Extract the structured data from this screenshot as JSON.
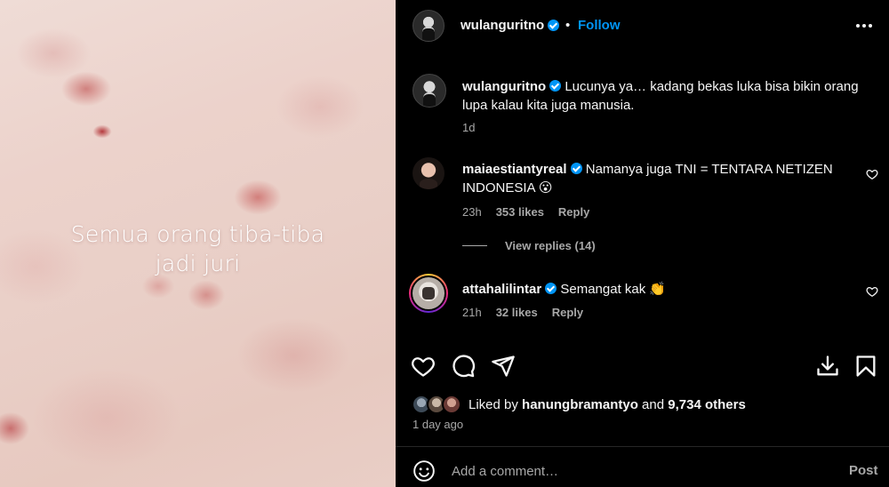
{
  "media": {
    "caption_lines": [
      "Semua orang tiba-tiba",
      "jadi juri"
    ]
  },
  "header": {
    "username": "wulanguritno",
    "dot": "•",
    "follow_label": "Follow"
  },
  "caption_comment": {
    "username": "wulanguritno",
    "text": "Lucunya ya… kadang bekas luka bisa bikin orang lupa kalau kita juga manusia.",
    "time": "1d"
  },
  "comments": [
    {
      "username": "maiaestiantyreal",
      "text": "Namanya juga TNI = TENTARA NETIZEN INDONESIA 😮",
      "time": "23h",
      "likes": "353 likes",
      "reply_label": "Reply"
    },
    {
      "username": "attahalilintar",
      "text": "Semangat kak 👏",
      "time": "21h",
      "likes": "32 likes",
      "reply_label": "Reply"
    }
  ],
  "view_replies": "View replies (14)",
  "likes_summary": {
    "prefix": "Liked by ",
    "user": "hanungbramantyo",
    "middle": " and ",
    "count": "9,734 others"
  },
  "posted_ago": "1 day ago",
  "add_comment": {
    "placeholder": "Add a comment…",
    "post_label": "Post"
  },
  "colors": {
    "accent": "#0095f6",
    "muted": "#a8a8a8",
    "background": "#000000"
  },
  "icons": [
    "more-icon",
    "verified-badge-icon",
    "heart-icon",
    "comment-icon",
    "share-icon",
    "save-download-icon",
    "bookmark-icon",
    "emoji-icon"
  ]
}
